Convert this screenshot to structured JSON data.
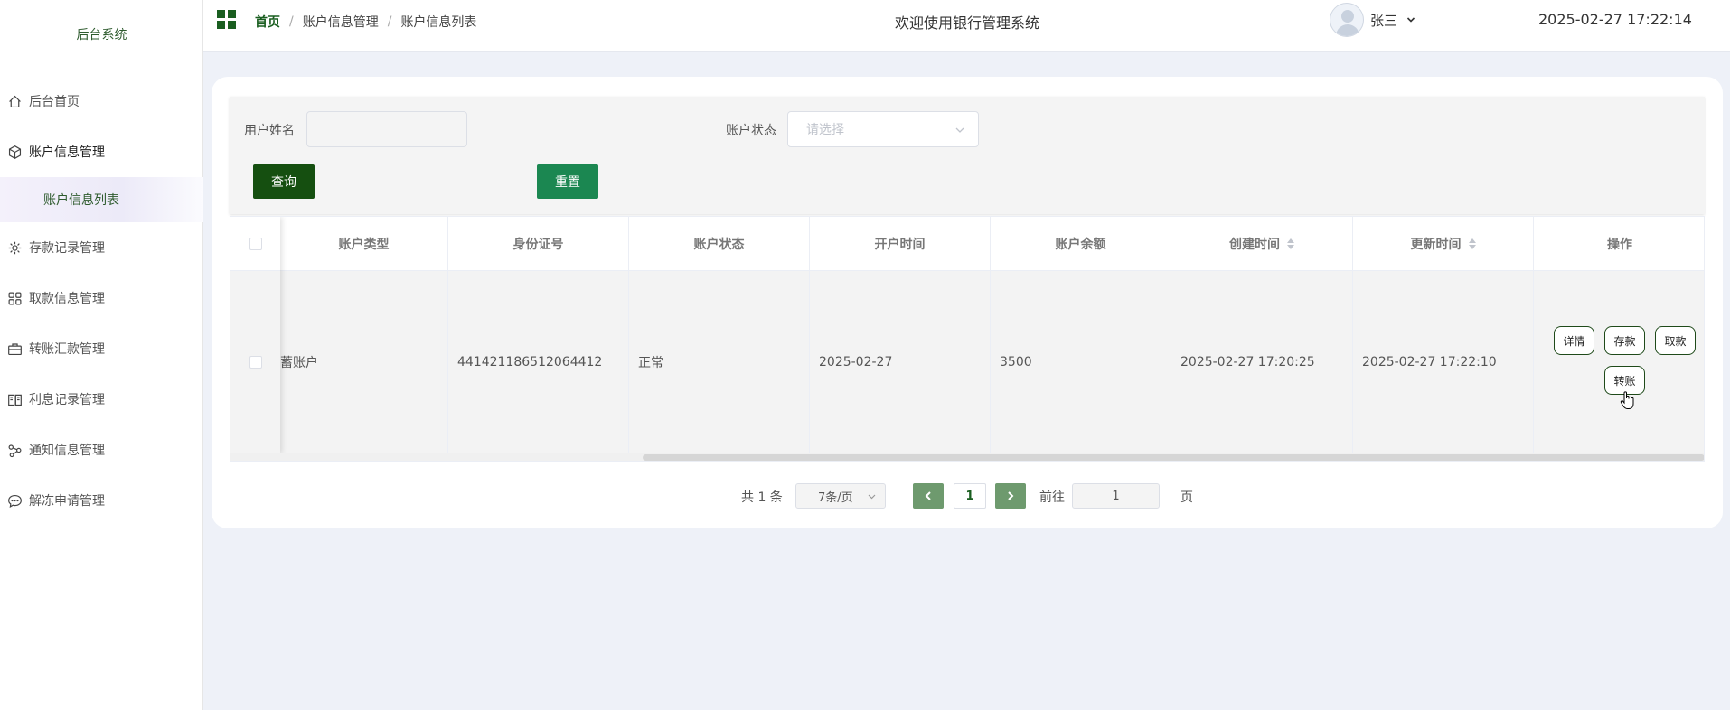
{
  "sidebar": {
    "brand": "后台系统",
    "items": [
      {
        "label": "后台首页",
        "icon": "home-icon"
      },
      {
        "label": "账户信息管理",
        "icon": "cube-icon"
      },
      {
        "label": "存款记录管理",
        "icon": "gear-icon"
      },
      {
        "label": "取款信息管理",
        "icon": "grid-icon"
      },
      {
        "label": "转账汇款管理",
        "icon": "briefcase-icon"
      },
      {
        "label": "利息记录管理",
        "icon": "book-icon"
      },
      {
        "label": "通知信息管理",
        "icon": "share-icon"
      },
      {
        "label": "解冻申请管理",
        "icon": "chat-icon"
      }
    ],
    "submenu": {
      "label": "账户信息列表"
    }
  },
  "header": {
    "breadcrumb": [
      "首页",
      "账户信息管理",
      "账户信息列表"
    ],
    "welcome": "欢迎使用银行管理系统",
    "username": "张三",
    "datetime": "2025-02-27 17:22:14"
  },
  "search": {
    "name_label": "用户姓名",
    "name_value": "",
    "status_label": "账户状态",
    "status_placeholder": "请选择",
    "query_button": "查询",
    "reset_button": "重置"
  },
  "table": {
    "columns": [
      "账户类型",
      "身份证号",
      "账户状态",
      "开户时间",
      "账户余额",
      "创建时间",
      "更新时间",
      "操作"
    ],
    "rows": [
      {
        "account_type": "蓄账户",
        "id_number": "441421186512064412",
        "status": "正常",
        "open_date": "2025-02-27",
        "balance": "3500",
        "created": "2025-02-27 17:20:25",
        "updated": "2025-02-27 17:22:10",
        "actions": [
          "详情",
          "存款",
          "取款",
          "转账"
        ]
      }
    ]
  },
  "pagination": {
    "total": "共 1 条",
    "page_size": "7条/页",
    "current_page": "1",
    "goto_label": "前往",
    "goto_value": "1",
    "page_suffix": "页"
  },
  "colors": {
    "primary_dark_green": "#154f10",
    "reset_green": "#1b8751",
    "pager_green": "#6e9a6e"
  }
}
